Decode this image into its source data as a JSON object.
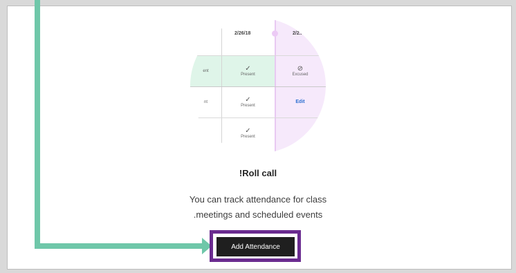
{
  "illustration": {
    "date_1": "2/26/18",
    "date_2": "2/2...",
    "cells": {
      "row1_left": "ent",
      "row1_mid": "Present",
      "row1_right": "Excused",
      "row2_left": "nt",
      "row2_mid": "Present",
      "row2_right": "Edit",
      "row3_mid": "Present"
    },
    "colors": {
      "present_highlight": "#dff5e9",
      "column_highlight": "#f6e9fb"
    }
  },
  "empty_state": {
    "title": "!Roll call",
    "description_line1": "You can track attendance for class",
    "description_line2": ".meetings and scheduled events"
  },
  "actions": {
    "add_attendance_label": "Add Attendance"
  },
  "annotation": {
    "arrow_color": "#6fc7a9",
    "frame_color": "#6a2b8f"
  }
}
